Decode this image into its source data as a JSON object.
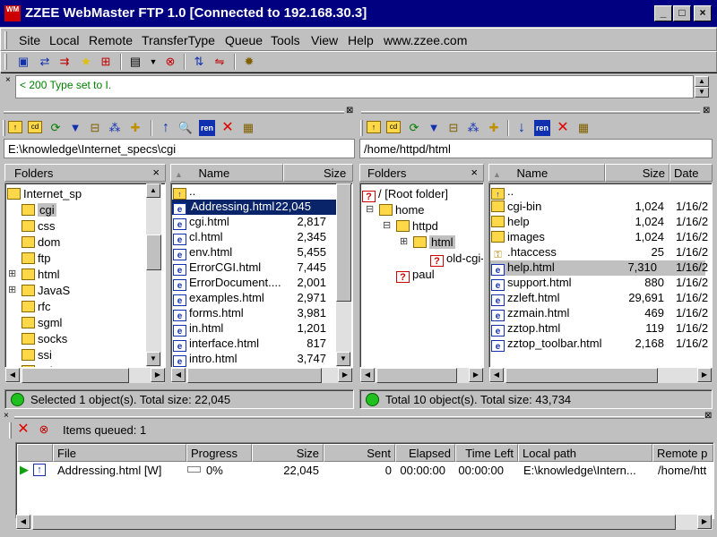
{
  "app": {
    "title": "ZZEE WebMaster FTP 1.0 [Connected to 192.168.30.3]",
    "icon_text": "WM",
    "minimize": "_",
    "maximize": "□",
    "close": "×"
  },
  "menu": [
    "Site",
    "Local",
    "Remote",
    "TransferType",
    "Queue",
    "Tools",
    "View",
    "Help",
    "www.zzee.com"
  ],
  "log": {
    "message": "< 200 Type set to I."
  },
  "local": {
    "path": "E:\\knowledge\\Internet_specs\\cgi",
    "folders_title": "Folders",
    "tree": [
      {
        "label": "Internet_sp",
        "level": 2,
        "expander": "⊟"
      },
      {
        "label": "cgi",
        "level": 3,
        "selected": true
      },
      {
        "label": "css",
        "level": 3
      },
      {
        "label": "dom",
        "level": 3
      },
      {
        "label": "ftp",
        "level": 3
      },
      {
        "label": "html",
        "level": 3,
        "expander": "⊞"
      },
      {
        "label": "JavaS",
        "level": 3,
        "expander": "⊞"
      },
      {
        "label": "rfc",
        "level": 3
      },
      {
        "label": "sgml",
        "level": 3
      },
      {
        "label": "socks",
        "level": 3
      },
      {
        "label": "ssi",
        "level": 3
      },
      {
        "label": "sol",
        "level": 3
      }
    ],
    "columns": {
      "name": "Name",
      "size": "Size"
    },
    "files": [
      {
        "name": "..",
        "size": "",
        "type": "up"
      },
      {
        "name": "Addressing.html",
        "size": "22,045",
        "type": "html",
        "selected": true
      },
      {
        "name": "cgi.html",
        "size": "2,817",
        "type": "html"
      },
      {
        "name": "cl.html",
        "size": "2,345",
        "type": "html"
      },
      {
        "name": "env.html",
        "size": "5,455",
        "type": "html"
      },
      {
        "name": "ErrorCGI.html",
        "size": "7,445",
        "type": "html"
      },
      {
        "name": "ErrorDocument....",
        "size": "2,001",
        "type": "html"
      },
      {
        "name": "examples.html",
        "size": "2,971",
        "type": "html"
      },
      {
        "name": "forms.html",
        "size": "3,981",
        "type": "html"
      },
      {
        "name": "in.html",
        "size": "1,201",
        "type": "html"
      },
      {
        "name": "interface.html",
        "size": "817",
        "type": "html"
      },
      {
        "name": "intro.html",
        "size": "3,747",
        "type": "html"
      }
    ],
    "status": "Selected 1 object(s). Total size: 22,045"
  },
  "remote": {
    "path": "/home/httpd/html",
    "folders_title": "Folders",
    "tree": [
      {
        "label": "/ [Root folder]",
        "level": 0,
        "icon": "root"
      },
      {
        "label": "home",
        "level": 1,
        "expander": "⊟"
      },
      {
        "label": "httpd",
        "level": 2,
        "expander": "⊟"
      },
      {
        "label": "html",
        "level": 3,
        "expander": "⊞",
        "selected": true
      },
      {
        "label": "old-cgi-bi",
        "level": 4,
        "icon": "unknown"
      },
      {
        "label": "paul",
        "level": 2,
        "icon": "unknown"
      }
    ],
    "columns": {
      "name": "Name",
      "size": "Size",
      "date": "Date"
    },
    "files": [
      {
        "name": "..",
        "size": "",
        "date": "",
        "type": "up"
      },
      {
        "name": "cgi-bin",
        "size": "1,024",
        "date": "1/16/2",
        "type": "folder"
      },
      {
        "name": "help",
        "size": "1,024",
        "date": "1/16/2",
        "type": "folder"
      },
      {
        "name": "images",
        "size": "1,024",
        "date": "1/16/2",
        "type": "folder"
      },
      {
        "name": ".htaccess",
        "size": "25",
        "date": "1/16/2",
        "type": "key"
      },
      {
        "name": "help.html",
        "size": "7,310",
        "date": "1/16/2",
        "type": "html",
        "selected": true
      },
      {
        "name": "support.html",
        "size": "880",
        "date": "1/16/2",
        "type": "html"
      },
      {
        "name": "zzleft.html",
        "size": "29,691",
        "date": "1/16/2",
        "type": "html"
      },
      {
        "name": "zzmain.html",
        "size": "469",
        "date": "1/16/2",
        "type": "html"
      },
      {
        "name": "zztop.html",
        "size": "119",
        "date": "1/16/2",
        "type": "html"
      },
      {
        "name": "zztop_toolbar.html",
        "size": "2,168",
        "date": "1/16/2",
        "type": "html"
      }
    ],
    "status": "Total 10 object(s). Total size: 43,734"
  },
  "queue": {
    "summary": "Items queued: 1",
    "columns": [
      "File",
      "Progress",
      "Size",
      "Sent",
      "Elapsed",
      "Time Left",
      "Local path",
      "Remote p"
    ],
    "items": [
      {
        "file": "Addressing.html [W]",
        "progress": "0%",
        "progress_fraction": 0,
        "size": "22,045",
        "sent": "0",
        "elapsed": "00:00:00",
        "time_left": "00:00:00",
        "local_path": "E:\\knowledge\\Intern...",
        "remote_path": "/home/htt"
      }
    ]
  },
  "colors": {
    "title_bg": "#000080",
    "selection_bg": "#0a246a",
    "status_ok": "#20c020",
    "log_text": "#008000"
  }
}
